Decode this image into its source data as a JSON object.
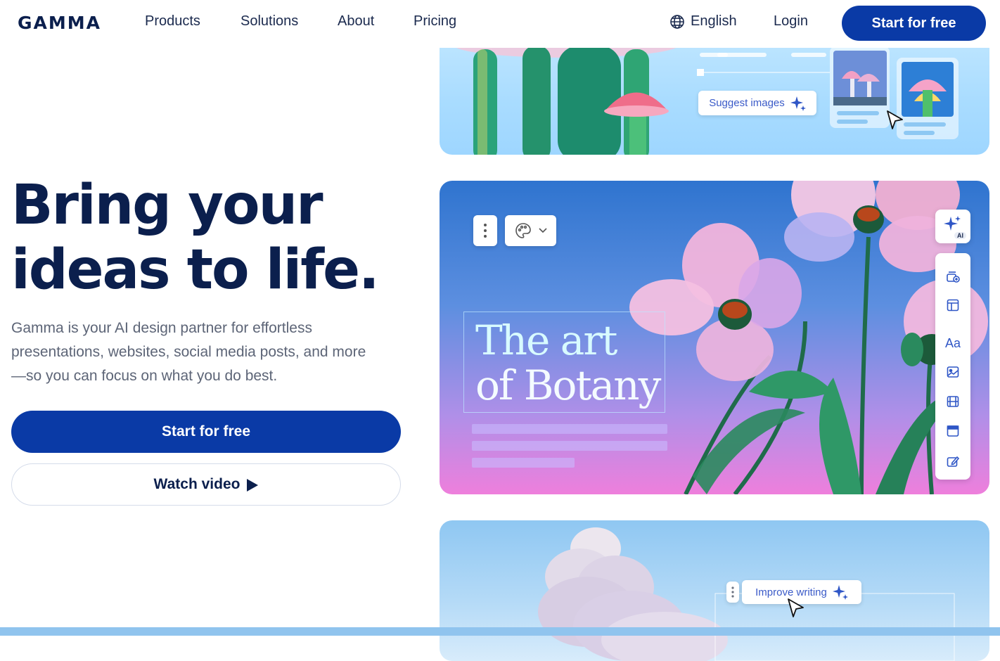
{
  "nav": {
    "logo": "GAMMA",
    "links": [
      "Products",
      "Solutions",
      "About",
      "Pricing"
    ],
    "language": "English",
    "login": "Login",
    "cta": "Start for free"
  },
  "hero": {
    "title_line1": "Bring your",
    "title_line2": "ideas to life.",
    "subtitle": "Gamma is your AI design partner for effortless presentations, websites, social media posts, and more—so you can focus on what you do best.",
    "primary_cta": "Start for free",
    "secondary_cta": "Watch video"
  },
  "card_top": {
    "suggest_chip": "Suggest images"
  },
  "card_mid": {
    "title_line1": "The art",
    "title_line2": "of Botany",
    "ai_badge": "AI",
    "rail_text_tool": "Aa"
  },
  "card_bot": {
    "improve_chip": "Improve writing"
  },
  "colors": {
    "brand_navy": "#0b1f4d",
    "brand_blue": "#0a3aa6",
    "accent": "#3a5ac8"
  }
}
